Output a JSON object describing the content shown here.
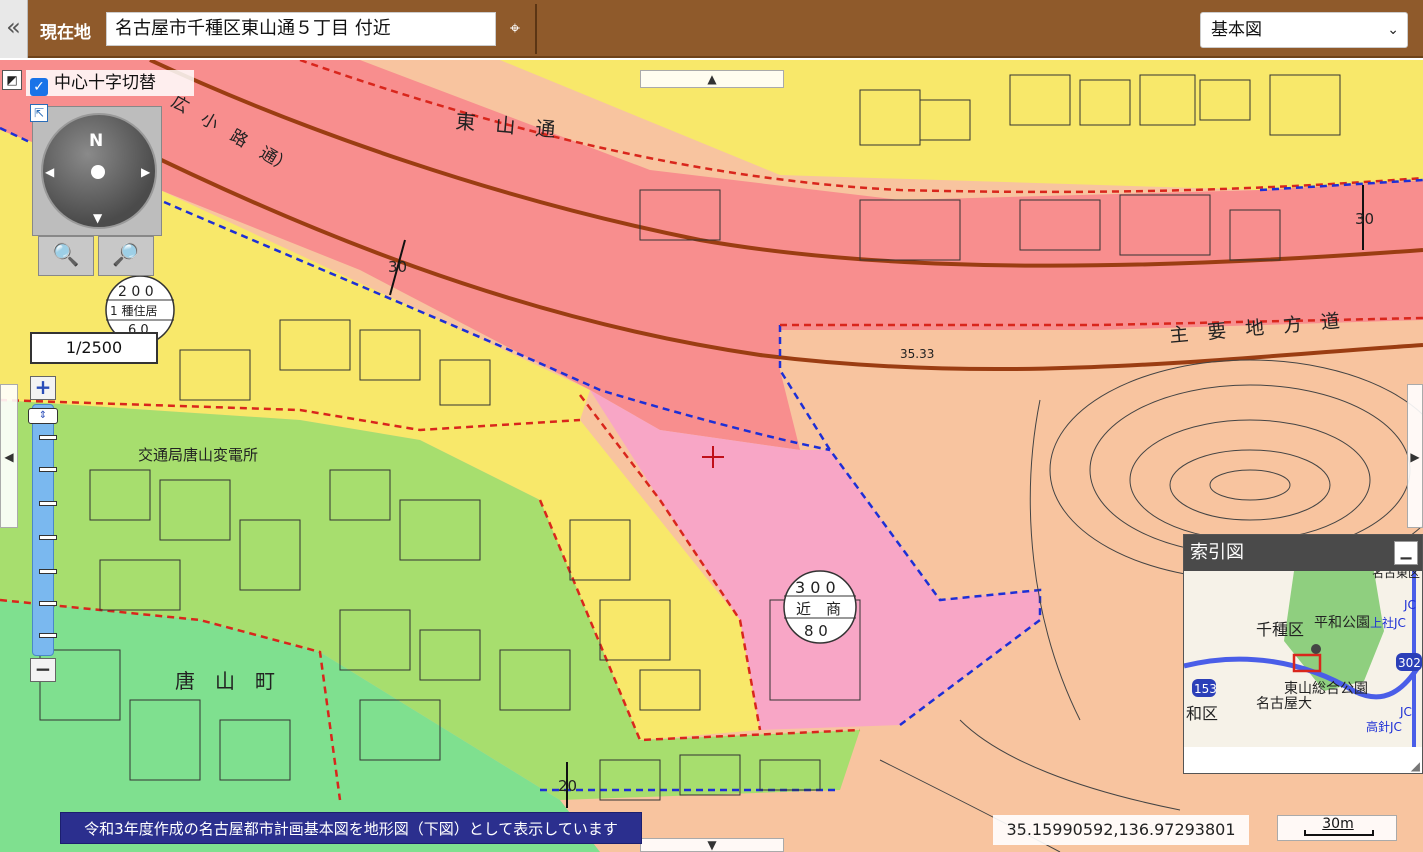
{
  "header": {
    "collapse": "«",
    "location_label": "現在地",
    "location_value": "名古屋市千種区東山通５丁目 付近",
    "locate_icon": "⌖",
    "map_type": "基本図",
    "select_arrow": "⌄"
  },
  "overlay": {
    "crosshair_toggle_label": "中心十字切替",
    "check_mark": "✓",
    "corner_icon": "◩",
    "corner_icon2": "⇱",
    "compass_n": "N",
    "zoom_in_icon": "🔍",
    "zoom_out_icon": "🔎",
    "scale": "1/2500",
    "slider_plus": "+",
    "slider_minus": "−",
    "slider_thumb": "⇕",
    "pan_up": "▲",
    "pan_down": "▼",
    "pan_left": "◀",
    "pan_right": "▶"
  },
  "index_map": {
    "title": "索引図",
    "minimize": "▁",
    "grip": "◢",
    "labels": {
      "chikusa": "千種区",
      "heiwa_park": "平和公園",
      "higashiyama_park": "東山総合公園",
      "meidai": "名古屋大",
      "wa_ku": "和区",
      "route153": "153",
      "route302": "302",
      "jc1": "JC",
      "jc2": "JC",
      "nagoya_higashi": "名古東区",
      "ueshi": "上社JC",
      "takahari": "高針JC"
    },
    "colors": {
      "road_blue": "#4a5ee8",
      "park_green": "#8fcf7f",
      "frame_red": "#d9261c"
    }
  },
  "map_labels": {
    "higashiyama_dori": "東　山　通",
    "komichi": "広　小　路　通）",
    "main_road": "主　要　地　方　道",
    "karayama": "唐　山　町",
    "substation": "交通局唐山変電所",
    "zone1_top": "2 0 0",
    "zone1_mid": "1 種住居",
    "zone1_bot": "6 0",
    "zone2_top": "3 0 0",
    "zone2_mid": "近　商",
    "zone2_bot": "8 0",
    "width30a": "30",
    "width30b": "30",
    "width20": "20",
    "elev_3533": "35.33"
  },
  "zones_colors": {
    "commercial": "#f88e8e",
    "neighborhood": "#f8a6c6",
    "residential1": "#f8e86a",
    "residential_low": "#a7de6e",
    "low_rise": "#7fe08f",
    "park": "#f8c49f"
  },
  "notice": "令和3年度作成の名古屋都市計画基本図を地形図（下図）として表示しています",
  "coords": "35.15990592,136.97293801",
  "scalebar": "30m"
}
